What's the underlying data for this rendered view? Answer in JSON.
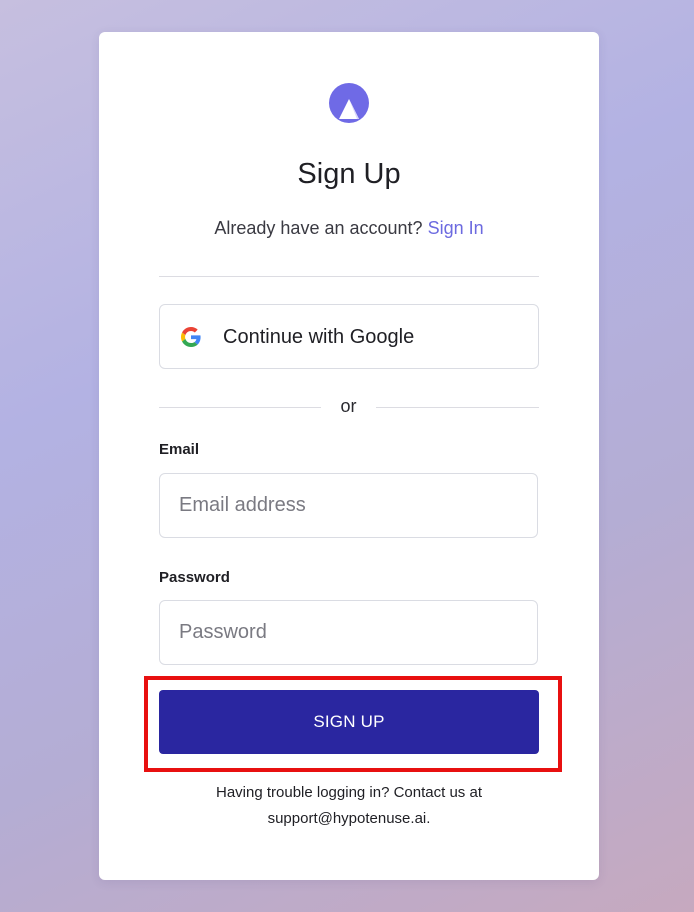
{
  "logo": {
    "icon": "triangle-logo-icon",
    "color": "#6f6ae6"
  },
  "title": "Sign Up",
  "subtitle": {
    "text": "Already have an account?",
    "link": "Sign In"
  },
  "google_button": {
    "icon": "google-icon",
    "label": "Continue with Google"
  },
  "divider_text": "or",
  "email": {
    "label": "Email",
    "placeholder": "Email address",
    "value": ""
  },
  "password": {
    "label": "Password",
    "placeholder": "Password",
    "value": ""
  },
  "signup_button": {
    "label": "SIGN UP",
    "color": "#2a26a0"
  },
  "highlight": {
    "color": "#e81010"
  },
  "footer": {
    "line1": "Having trouble logging in? Contact us at",
    "line2": "support@hypotenuse.ai."
  }
}
